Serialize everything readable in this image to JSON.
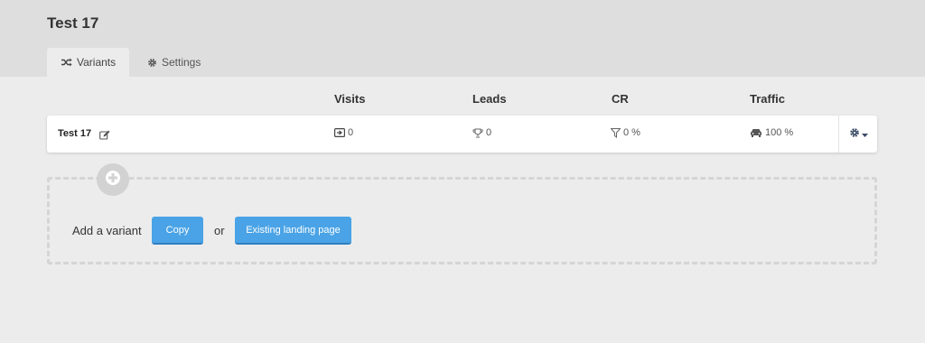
{
  "page": {
    "title": "Test 17"
  },
  "tabs": [
    {
      "label": "Variants",
      "icon": "shuffle-icon",
      "active": true
    },
    {
      "label": "Settings",
      "icon": "gear-icon",
      "active": false
    }
  ],
  "columns": [
    "Visits",
    "Leads",
    "CR",
    "Traffic"
  ],
  "variants": [
    {
      "name": "Test 17",
      "visits": "0",
      "leads": "0",
      "cr": "0 %",
      "traffic": "100 %"
    }
  ],
  "add_variant": {
    "label": "Add a variant",
    "copy_label": "Copy",
    "or_label": "or",
    "existing_label": "Existing landing page"
  },
  "colors": {
    "accent": "#4aa3e6",
    "header_bg": "#dedede",
    "page_bg": "#ececec"
  }
}
